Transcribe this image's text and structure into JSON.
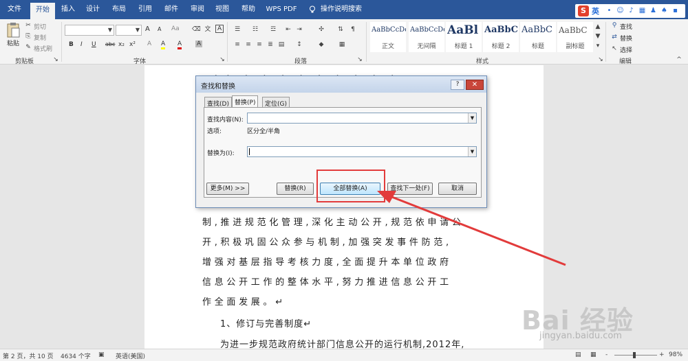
{
  "menubar": {
    "tabs": [
      "文件",
      "开始",
      "插入",
      "设计",
      "布局",
      "引用",
      "邮件",
      "审阅",
      "视图",
      "帮助",
      "WPS PDF",
      "操作说明搜索"
    ],
    "active_tab": "开始",
    "ime_lang": "英",
    "ime_logo": "S"
  },
  "ribbon": {
    "clipboard": {
      "paste": "粘贴",
      "cut": "剪切",
      "copy": "复制",
      "format_painter": "格式刷",
      "label": "剪贴板"
    },
    "font": {
      "label": "字体",
      "bold": "B",
      "italic": "I",
      "underline": "U",
      "strike": "abc",
      "sub": "x₂",
      "sup": "x²",
      "grow": "A",
      "shrink": "A",
      "case": "Aa",
      "clear": "A",
      "highlight": "A",
      "color": "A",
      "box": "A"
    },
    "paragraph": {
      "label": "段落"
    },
    "styles": {
      "label": "样式",
      "items": [
        {
          "preview": "AaBbCcDd",
          "name": "正文"
        },
        {
          "preview": "AaBbCcDd",
          "name": "无间隔"
        },
        {
          "preview": "AaBl",
          "name": "标题 1"
        },
        {
          "preview": "AaBbC",
          "name": "标题 2"
        },
        {
          "preview": "AaBbC",
          "name": "标题"
        },
        {
          "preview": "AaBbC",
          "name": "副标题"
        }
      ]
    },
    "editing": {
      "find": "查找",
      "replace": "替换",
      "select": "选择",
      "label": "编辑"
    }
  },
  "dialog": {
    "title": "查找和替换",
    "help": "?",
    "close": "✕",
    "tabs": [
      "查找(D)",
      "替换(P)",
      "定位(G)"
    ],
    "active_tab": "替换(P)",
    "find_label": "查找内容(N):",
    "options_label": "选项:",
    "options_value": "区分全/半角",
    "replace_label": "替换为(I):",
    "find_value": "",
    "replace_value": "",
    "buttons": {
      "more": "更多(M) >>",
      "replace": "替换(R)",
      "replace_all": "全部替换(A)",
      "find_next": "查找下一处(F)",
      "cancel": "取消"
    }
  },
  "document": {
    "lines": [
      "制,推进规范化管理,深化主动公开,规范依申请公",
      "开,积极巩固公众参与机制,加强突发事件防范,",
      "增强对基层指导考核力度,全面提升本单位政府",
      "信息公开工作的整体水平,努力推进信息公开工",
      "作全面发展。↵"
    ],
    "heading": "1、修订与完善制度↵",
    "last_line": "为进一步规范政府统计部门信息公开的运行机制,2012年,"
  },
  "statusbar": {
    "page": "第 2 页，共 10 页",
    "words": "4634 个字",
    "lang": "英语(美国)",
    "zoom_minus": "-",
    "zoom_plus": "+",
    "zoom": "98%"
  },
  "watermark": {
    "brand": "Bai 经验",
    "url": "jingyan.baidu.com"
  },
  "colors": {
    "accent": "#2b579a",
    "annotation": "#e23b3b"
  }
}
